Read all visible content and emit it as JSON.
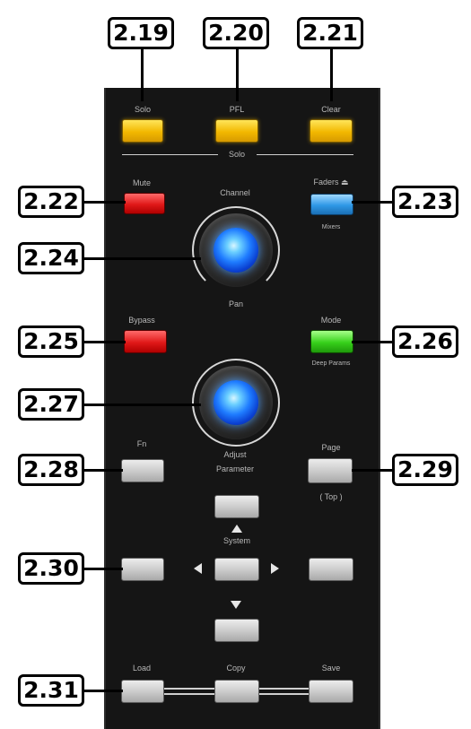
{
  "callouts": {
    "c219": "2.19",
    "c220": "2.20",
    "c221": "2.21",
    "c222": "2.22",
    "c223": "2.23",
    "c224": "2.24",
    "c225": "2.25",
    "c226": "2.26",
    "c227": "2.27",
    "c228": "2.28",
    "c229": "2.29",
    "c230": "2.30",
    "c231": "2.31"
  },
  "labels": {
    "solo_left": "Solo",
    "solo_mid": "PFL",
    "solo_right": "Clear",
    "solo_group": "Solo",
    "mute": "Mute",
    "channel": "Channel",
    "faders": "Faders ⏏",
    "faders_sub": "Mixers",
    "pan": "Pan",
    "bypass": "Bypass",
    "mode": "Mode",
    "mode_sub": "Deep Params",
    "fn": "Fn",
    "adjust": "Adjust",
    "parameter": "Parameter",
    "page": "Page",
    "page_sub": "( Top )",
    "system": "System",
    "load": "Load",
    "copy": "Copy",
    "save": "Save"
  },
  "colors": {
    "panel": "#151515",
    "yellow": "#f2b800",
    "red": "#e01818",
    "blue": "#2f98e6",
    "green": "#36d01a",
    "knob_glow": "#1f7cff"
  }
}
